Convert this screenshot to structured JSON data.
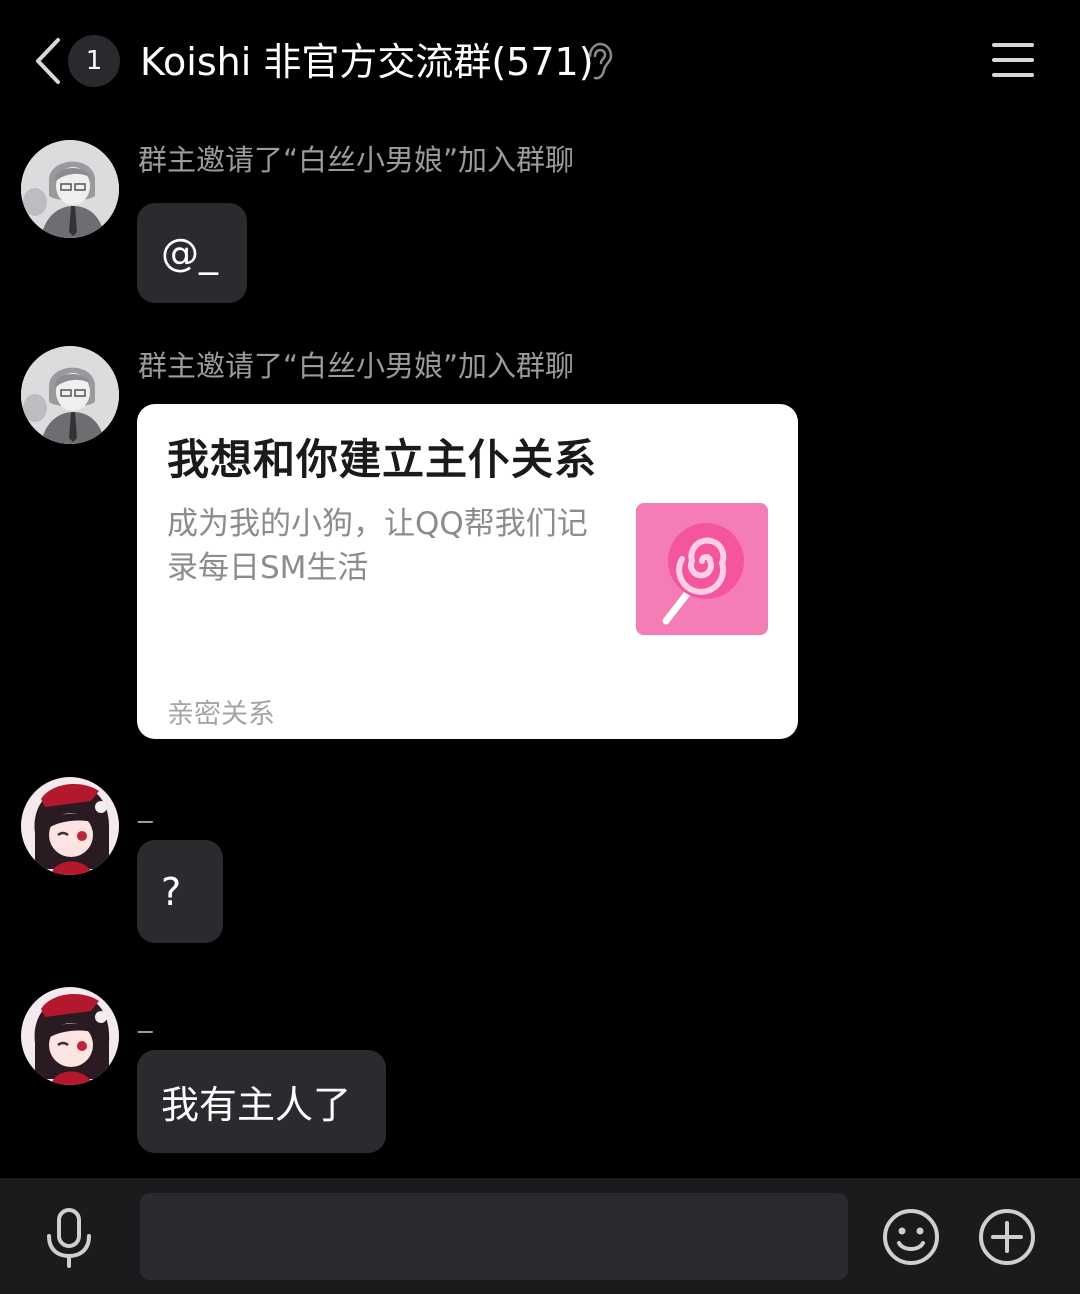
{
  "header": {
    "unread_count": "1",
    "title": "Koishi 非官方交流群(571)",
    "icons": [
      "back-icon",
      "ear-icon",
      "menu-icon"
    ]
  },
  "messages": [
    {
      "sender": "群主邀请了“白丝小男娘”加入群聊",
      "text": "@_",
      "avatar": "gray-anime-avatar"
    },
    {
      "sender": "群主邀请了“白丝小男娘”加入群聊",
      "card": {
        "title": "我想和你建立主仆关系",
        "description": "成为我的小狗，让QQ帮我们记录每日SM生活",
        "tag": "亲密关系",
        "thumb_icon": "lollipop-icon"
      },
      "avatar": "gray-anime-avatar"
    },
    {
      "sender": "_",
      "text": "?",
      "avatar": "red-anime-avatar"
    },
    {
      "sender": "_",
      "text": "我有主人了",
      "avatar": "red-anime-avatar"
    }
  ],
  "input_bar": {
    "placeholder": "",
    "icons": [
      "mic-icon",
      "emoji-icon",
      "plus-icon"
    ]
  },
  "colors": {
    "background": "#000000",
    "bubble": "#2b2a2f",
    "input_bar": "#1b1b1d",
    "sender_text": "#9b9b9b",
    "lollipop": "#f37db4"
  }
}
